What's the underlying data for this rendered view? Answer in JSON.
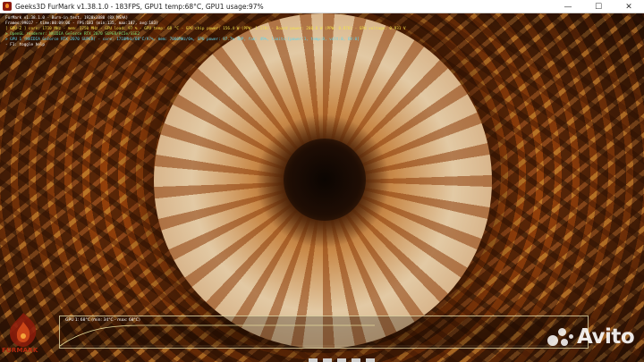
{
  "window": {
    "title": "Geeks3D FurMark v1.38.1.0 - 183FPS, GPU1 temp:68°C, GPU1 usage:97%",
    "controls": {
      "minimize": "—",
      "maximize": "☐",
      "close": "✕"
    }
  },
  "osd": {
    "lines": [
      {
        "text": "FurMark v1.38.1.0 - Burn-in test, 1920x1080 (8X MSAA)",
        "color": "white"
      },
      {
        "text": "Frames:99017 - time:00:09:06 - FPS:183 (min:135, max:187, avg:183)",
        "color": "white"
      },
      {
        "text": "[ GPU-Z ] core: 1710 MHz - mem: 1750 MHz - GPU load: 97 % - GPU temp: 68 °C - GPU chip power: 156.4 W (PPW: 1.170) - Board power: 208.8 W (PPW: 0.876) - GPU voltage: 0.931 V",
        "color": "yellow"
      },
      {
        "text": "> OpenGL renderer: NVIDIA GeForce RTX 2070 SUPER/PCIe/SSE2",
        "color": "green"
      },
      {
        "text": "> GPU 1 (NVIDIA GeForce RTX 2070 SUPER) - core: 1710MHz/68°C/97%, mem: 7000MHz/6%, GPU power: 97.7% TDP, fan: 49%, limits:[power:1, temp:0, volt:0, OV:0]",
        "color": "cyan"
      },
      {
        "text": "- F1: toggle help",
        "color": "white"
      }
    ]
  },
  "graph": {
    "label": "GPU 1: 68°C (min: 34°C - max: 68°C)",
    "temp_min_c": 34,
    "temp_max_c": 68,
    "current_c": 68
  },
  "logo": {
    "text": "FURMARK"
  },
  "watermark": {
    "text": "Avito"
  },
  "colors": {
    "osd_white": "#ffffff",
    "osd_yellow": "#f2e14a",
    "osd_green": "#7fe07a",
    "osd_cyan": "#5fd7f0",
    "graph_line": "#e6dc9a"
  }
}
